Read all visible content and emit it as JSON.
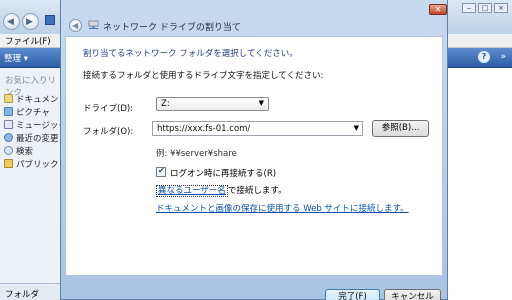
{
  "explorer": {
    "menu_file": "ファイル(F)",
    "toolbar_organize": "整理 ▾",
    "toolbar_help": "?",
    "toolbar_more": "»",
    "favorites_header": "お気に入りリンク",
    "nav_items": [
      {
        "label": "ドキュメント",
        "icon": "documents-icon"
      },
      {
        "label": "ピクチャ",
        "icon": "pictures-icon"
      },
      {
        "label": "ミュージック",
        "icon": "music-icon"
      },
      {
        "label": "最近の変更",
        "icon": "recent-changes-icon"
      },
      {
        "label": "検索",
        "icon": "search-icon"
      },
      {
        "label": "パブリック",
        "icon": "public-folder-icon"
      }
    ],
    "folder_bar_label": "フォルダ"
  },
  "dialog": {
    "title": "ネットワーク ドライブの割り当て",
    "close_glyph": "✕",
    "instruction_title": "割り当てるネットワーク フォルダを選択してください。",
    "instruction_sub": "接続するフォルダと使用するドライブ文字を指定してください:",
    "drive_label": "ドライブ(D):",
    "drive_value": "Z:",
    "folder_label": "フォルダ(O):",
    "folder_value": "https://xxx.fs-01.com/",
    "browse_label": "参照(B)...",
    "example_text": "例: ¥¥server¥share",
    "reconnect_checked": true,
    "reconnect_label": "ログオン時に再接続する(R)",
    "different_user_link": "異なるユーザー名",
    "different_user_suffix": "で接続します。",
    "document_site_link": "ドキュメントと画像の保存に使用する Web サイトに接続します。",
    "finish_label": "完了(F)",
    "cancel_label": "キャンセル"
  },
  "colors": {
    "accent_blue": "#1f3e8a",
    "link_blue": "#0b4fa8",
    "toolbar_blue": "#2c5ea8"
  }
}
